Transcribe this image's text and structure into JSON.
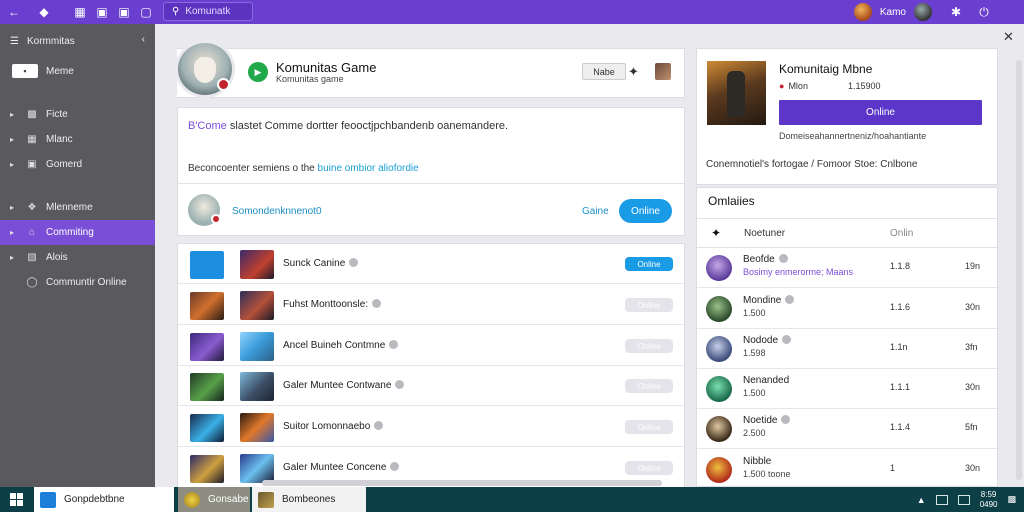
{
  "topbar": {
    "search_placeholder": "Komunatk",
    "user_name": "Kamo",
    "colors": {
      "bar": "#6a3fd0"
    }
  },
  "sidebar": {
    "header_label": "Kormmitas",
    "items": [
      {
        "label": "Meme",
        "icon": "gamepad-icon"
      },
      {
        "label": "Ficte",
        "icon": "box-icon"
      },
      {
        "label": "Mlanc",
        "icon": "grid-icon"
      },
      {
        "label": "Gomerd",
        "icon": "monitor-icon"
      },
      {
        "label": "Mlenneme",
        "icon": "puzzle-icon"
      },
      {
        "label": "Commiting",
        "icon": "home-icon",
        "active": true
      },
      {
        "label": "Alois",
        "icon": "folder-icon"
      },
      {
        "label": "Communtir Online",
        "icon": "chat-icon"
      }
    ]
  },
  "profile": {
    "title": "Komunitas Game",
    "subtitle": "Komunitas game",
    "mode_button": "Nabe"
  },
  "description": {
    "headline_prefix": "B'Come",
    "headline_rest": " slastet Comme dortter feooctjpchbandenb oanemandere.",
    "line_prefix": "Beconcoenter semiens o the ",
    "line_link": "buine ombior aliofordie",
    "user_name": "Somondenknnenot0",
    "status_label": "Gaine",
    "online_button": "Online"
  },
  "games": [
    {
      "name": "Sunck Canine",
      "button": "Online",
      "online": true
    },
    {
      "name": "Fuhst Monttoonsle:",
      "button": "Online",
      "online": false
    },
    {
      "name": "Ancel Buineh Contmne",
      "button": "Online",
      "online": false
    },
    {
      "name": "Galer Muntee Contwane",
      "button": "Online",
      "online": false
    },
    {
      "name": "Suitor Lomonnaebo",
      "button": "Online",
      "online": false
    },
    {
      "name": "Galer Muntee Concene",
      "button": "Online",
      "online": false
    }
  ],
  "featured": {
    "title": "Komunitaig Mbne",
    "meta1": "Mlon",
    "meta2": "1.15900",
    "online_button": "Online",
    "note": "Domeiseahannertneniz/hoahantiante",
    "footer": "Conemnotiel's fortogae / Fomoor Stoe: Cnlbone"
  },
  "players": {
    "title": "Omlaiies",
    "header_name": "Noetuner",
    "header_status": "Onlin",
    "rows": [
      {
        "name": "Beofde",
        "sub": "Bosimy enmerorme; Maans",
        "accent": true,
        "c1": "1.1.8",
        "c2": "19n"
      },
      {
        "name": "Mondine",
        "sub": "1.500",
        "accent": false,
        "c1": "1.1.6",
        "c2": "30n"
      },
      {
        "name": "Nodode",
        "sub": "1.598",
        "accent": false,
        "c1": "1.1n",
        "c2": "3fn"
      },
      {
        "name": "Nenanded",
        "sub": "1.500",
        "accent": false,
        "c1": "1.1.1",
        "c2": "30n"
      },
      {
        "name": "Noetide",
        "sub": "2.500",
        "accent": false,
        "c1": "1.1.4",
        "c2": "5fn"
      },
      {
        "name": "Nibble",
        "sub": "1.500 toone",
        "accent": false,
        "c1": "1",
        "c2": "30n"
      }
    ]
  },
  "taskbar": {
    "items": [
      "Gonpdebtbne",
      "Gonsabe",
      "Bombeones"
    ],
    "clock_time": "8:59",
    "clock_date": "0490"
  }
}
